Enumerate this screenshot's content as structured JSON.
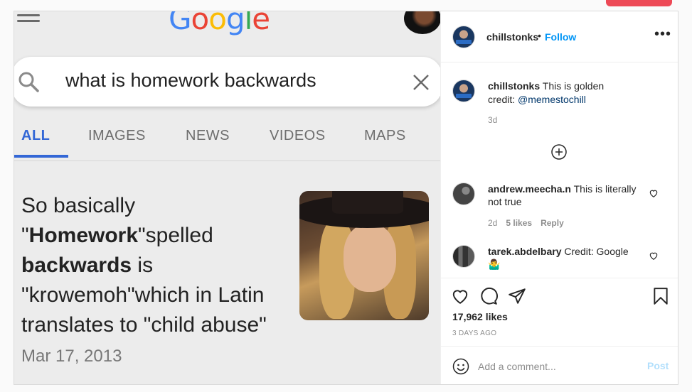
{
  "post": {
    "image": {
      "logo_text": "Google",
      "search_query": "what is homework backwards",
      "tabs": [
        "ALL",
        "IMAGES",
        "NEWS",
        "VIDEOS",
        "MAPS"
      ],
      "snippet": {
        "part1": "So basically \"",
        "bold1": "Homework",
        "part2": "\"spelled ",
        "bold2": "backwards",
        "part3": " is \"krowemoh\"which in Latin translates to \"child abuse\" ",
        "date": "Mar 17, 2013"
      }
    },
    "header": {
      "username": "chillstonks",
      "separator": "•",
      "follow_label": "Follow",
      "more_icon": "more-horizontal-icon"
    },
    "caption": {
      "username": "chillstonks",
      "text": "This is golden",
      "credit_prefix": "credit: ",
      "credit_handle": "@memestochill",
      "time": "3d"
    },
    "comments": [
      {
        "username": "andrew.meecha.n",
        "text": "This is literally not true",
        "time": "2d",
        "likes": "5 likes",
        "reply": "Reply"
      },
      {
        "username": "tarek.abdelbary",
        "text": "Credit: Google",
        "emoji": "🤷‍♂️"
      }
    ],
    "actions": {
      "likes": "17,962 likes",
      "posted": "3 DAYS AGO"
    },
    "add_comment": {
      "placeholder": "Add a comment...",
      "post_label": "Post"
    },
    "colors": {
      "link": "#0095f6",
      "post_disabled": "#b2dffc",
      "alert": "#ed4956"
    }
  }
}
